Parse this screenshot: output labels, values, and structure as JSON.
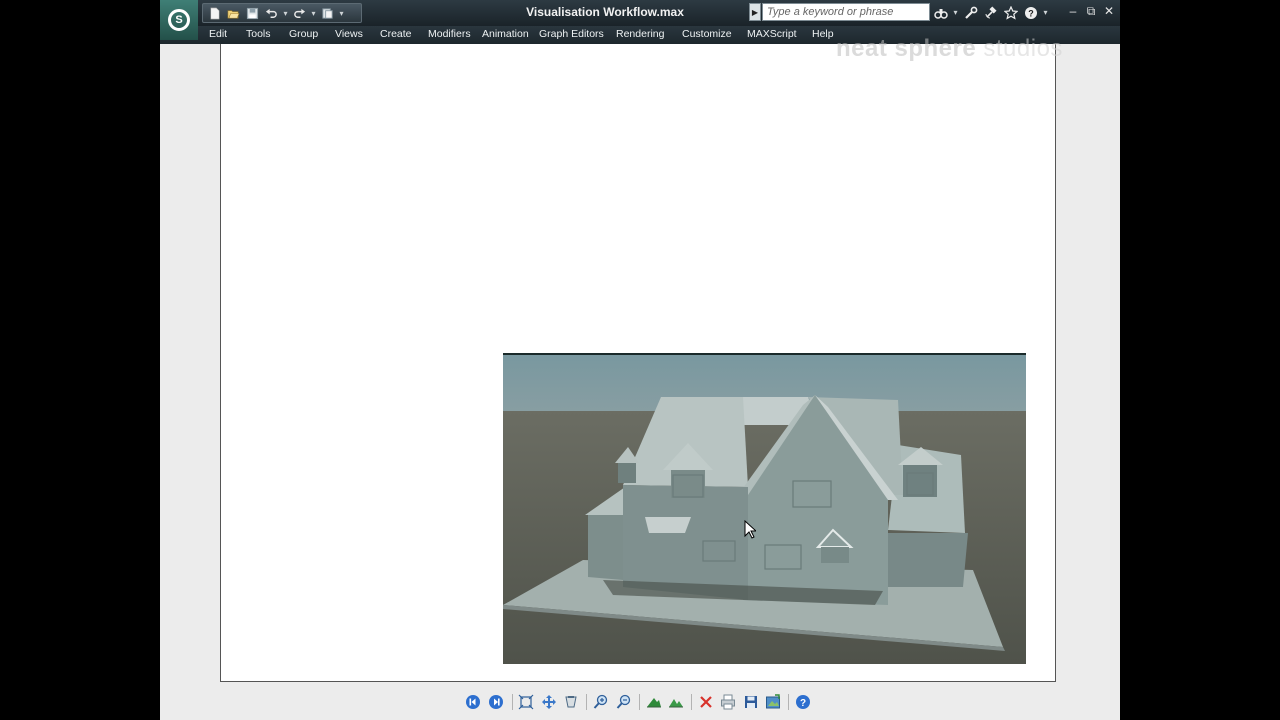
{
  "window": {
    "title": "Visualisation Workflow.max",
    "app_icon": "3ds-max-logo-icon",
    "app_logo_letter": "S"
  },
  "quick_access": {
    "icons": [
      "new-file-icon",
      "open-file-icon",
      "save-icon",
      "undo-icon",
      "redo-icon",
      "project-folder-icon"
    ]
  },
  "infocenter": {
    "search_placeholder": "Type a keyword or phrase",
    "icons": [
      "binoculars-icon",
      "wrench-icon",
      "satellite-icon",
      "star-icon",
      "help-icon"
    ]
  },
  "window_controls": [
    "minimize-icon",
    "restore-icon",
    "close-icon"
  ],
  "menu": {
    "items": [
      "Edit",
      "Tools",
      "Group",
      "Views",
      "Create",
      "Modifiers",
      "Animation",
      "Graph Editors",
      "Rendering",
      "Customize",
      "MAXScript",
      "Help"
    ]
  },
  "watermark": {
    "bold": "neat sphere",
    "light": " studios"
  },
  "render": {
    "subject": "house-render-image",
    "sky_color": "#7e9ba3",
    "ground_color": "#5a5d54",
    "model_color": "#8ea3a1"
  },
  "viewer_toolbar": {
    "icons": [
      "first-page-icon",
      "next-page-icon",
      "fit-to-window-icon",
      "pan-icon",
      "page-setup-icon",
      "zoom-in-icon",
      "zoom-out-icon",
      "markup-icon",
      "markup-measure-icon",
      "delete-icon",
      "print-icon",
      "save-image-icon",
      "export-icon",
      "help-icon"
    ]
  }
}
